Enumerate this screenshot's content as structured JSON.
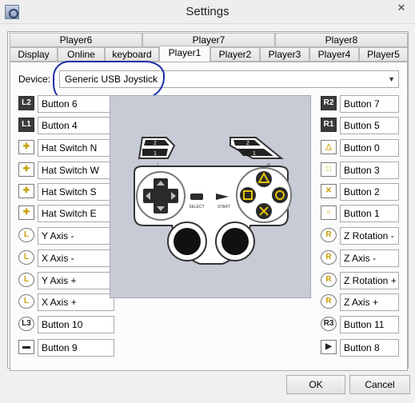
{
  "window": {
    "title": "Settings",
    "close": "✕"
  },
  "tabs_row1": [
    "Player6",
    "Player7",
    "Player8"
  ],
  "tabs_row2": [
    "Display",
    "Online",
    "keyboard",
    "Player1",
    "Player2",
    "Player3",
    "Player4",
    "Player5"
  ],
  "device": {
    "label": "Device:",
    "value": "Generic   USB  Joystick"
  },
  "left_mappings": [
    {
      "icon": "L2",
      "label": "Button 6"
    },
    {
      "icon": "L1",
      "label": "Button 4"
    },
    {
      "icon": "✚",
      "label": "Hat Switch N"
    },
    {
      "icon": "✚",
      "label": "Hat Switch W"
    },
    {
      "icon": "✚",
      "label": "Hat Switch S"
    },
    {
      "icon": "✚",
      "label": "Hat Switch E"
    },
    {
      "icon": "L",
      "label": "Y Axis -"
    },
    {
      "icon": "L",
      "label": "X Axis -"
    },
    {
      "icon": "L",
      "label": "Y Axis +"
    },
    {
      "icon": "L",
      "label": "X Axis +"
    },
    {
      "icon": "L3",
      "label": "Button 10"
    },
    {
      "icon": "▬",
      "label": "Button 9"
    }
  ],
  "right_mappings": [
    {
      "icon": "R2",
      "label": "Button 7"
    },
    {
      "icon": "R1",
      "label": "Button 5"
    },
    {
      "icon": "△",
      "label": "Button 0"
    },
    {
      "icon": "□",
      "label": "Button 3"
    },
    {
      "icon": "✕",
      "label": "Button 2"
    },
    {
      "icon": "○",
      "label": "Button 1"
    },
    {
      "icon": "R",
      "label": "Z Rotation -"
    },
    {
      "icon": "R",
      "label": "Z Axis -"
    },
    {
      "icon": "R",
      "label": "Z Rotation +"
    },
    {
      "icon": "R",
      "label": "Z Axis +"
    },
    {
      "icon": "R3",
      "label": "Button 11"
    },
    {
      "icon": "▶",
      "label": "Button 8"
    }
  ],
  "controller": {
    "l_label": "L",
    "r_label": "R",
    "l_bump": [
      "2",
      "1"
    ],
    "r_bump": [
      "2",
      "1"
    ],
    "select": "SELECT",
    "start": "START"
  },
  "footer": {
    "ok": "OK",
    "cancel": "Cancel"
  }
}
